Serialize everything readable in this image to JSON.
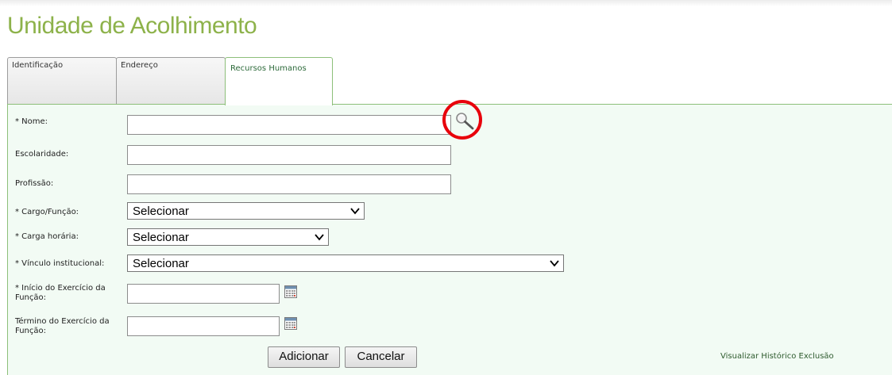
{
  "page": {
    "title": "Unidade de Acolhimento"
  },
  "tabs": [
    {
      "label": "Identificação",
      "active": false
    },
    {
      "label": "Endereço",
      "active": false
    },
    {
      "label": "Recursos Humanos",
      "active": true
    }
  ],
  "form": {
    "nome": {
      "label": "* Nome:",
      "value": ""
    },
    "escolaridade": {
      "label": "Escolaridade:",
      "value": ""
    },
    "profissao": {
      "label": "Profissão:",
      "value": ""
    },
    "cargo_funcao": {
      "label": "* Cargo/Função:",
      "selected": "Selecionar"
    },
    "carga_horaria": {
      "label": "* Carga horária:",
      "selected": "Selecionar"
    },
    "vinculo": {
      "label": "* Vínculo institucional:",
      "selected": "Selecionar"
    },
    "inicio": {
      "label": "* Início do Exercício da Função:",
      "value": ""
    },
    "termino": {
      "label": "Término do Exercício da Função:",
      "value": ""
    }
  },
  "buttons": {
    "add": "Adicionar",
    "cancel": "Cancelar"
  },
  "links": {
    "history": "Visualizar Histórico Exclusão"
  },
  "icons": {
    "search": "magnifier-icon",
    "calendar": "calendar-icon",
    "dropdown": "chevron-down-icon"
  },
  "colors": {
    "title": "#8db24a",
    "panel_bg": "#f2fbf4",
    "panel_border": "#8dbf7a",
    "highlight": "#e8000b"
  }
}
